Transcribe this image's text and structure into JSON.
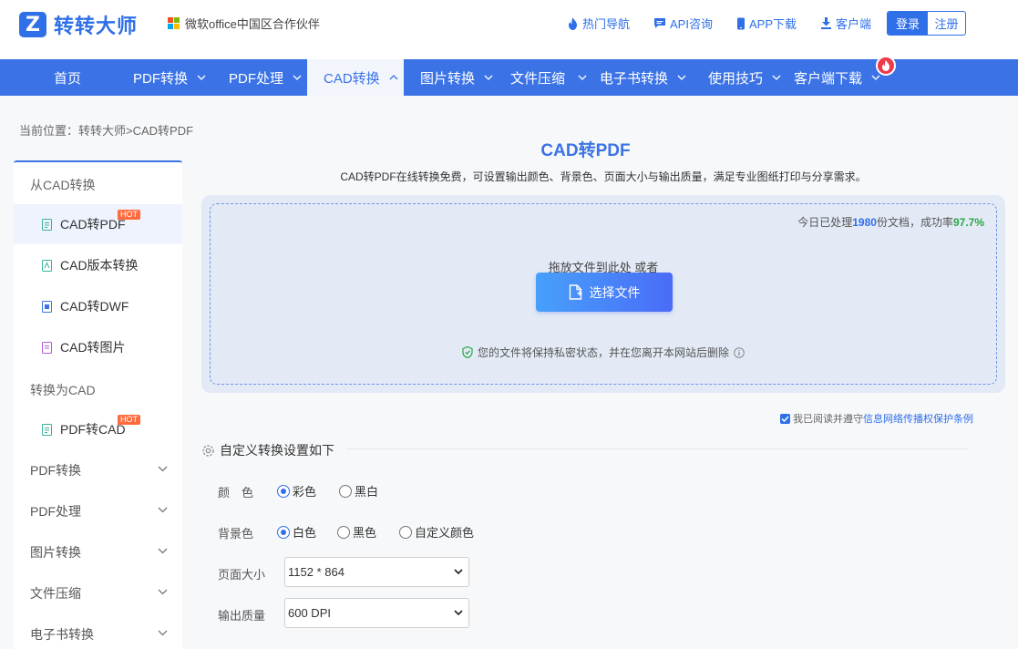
{
  "header": {
    "logo_mark": "Z",
    "logo_text": "转转大师",
    "partner": "微软office中国区合作伙伴",
    "links": [
      {
        "label": "热门导航",
        "icon": "fire-icon"
      },
      {
        "label": "API咨询",
        "icon": "chat-icon"
      },
      {
        "label": "APP下载",
        "icon": "phone-icon"
      },
      {
        "label": "客户端",
        "icon": "download-icon"
      }
    ],
    "login": "登录",
    "register": "注册"
  },
  "nav": {
    "items": [
      "首页",
      "PDF转换",
      "PDF处理",
      "CAD转换",
      "图片转换",
      "文件压缩",
      "电子书转换",
      "使用技巧",
      "客户端下载"
    ],
    "active": "CAD转换"
  },
  "breadcrumb": "当前位置：转转大师>CAD转PDF",
  "sidebar": {
    "group_from_cad": "从CAD转换",
    "items_from": [
      {
        "label": "CAD转PDF",
        "hot": "HOT",
        "active": true
      },
      {
        "label": "CAD版本转换"
      },
      {
        "label": "CAD转DWF"
      },
      {
        "label": "CAD转图片"
      }
    ],
    "group_to_cad": "转换为CAD",
    "items_to": [
      {
        "label": "PDF转CAD",
        "hot": "HOT"
      }
    ],
    "collapsibles": [
      "PDF转换",
      "PDF处理",
      "图片转换",
      "文件压缩",
      "电子书转换"
    ]
  },
  "main": {
    "title": "CAD转PDF",
    "description": "CAD转PDF在线转换免费，可设置输出颜色、背景色、页面大小与输出质量，满足专业图纸打印与分享需求。",
    "stats_prefix": "今日已处理",
    "stats_count": "1980",
    "stats_mid": "份文档，成功率",
    "stats_rate": "97.7%",
    "drop_hint": "拖放文件到此处 或者",
    "choose_button": "选择文件",
    "privacy": "您的文件将保持私密状态，并在您离开本网站后删除",
    "agree_prefix": "我已阅读并遵守",
    "agree_link": "信息网络传播权保护条例",
    "settings_title": "自定义转换设置如下"
  },
  "options": {
    "color_label": "颜　色",
    "color_choices": [
      "彩色",
      "黑白"
    ],
    "color_selected": "彩色",
    "bg_label": "背景色",
    "bg_choices": [
      "白色",
      "黑色",
      "自定义颜色"
    ],
    "bg_selected": "白色",
    "page_size_label": "页面大小",
    "page_size_value": "1152 * 864",
    "quality_label": "输出质量",
    "quality_value": "600 DPI"
  },
  "colors": {
    "brand": "#2f6fe8",
    "nav_bg": "#3b73e6",
    "hot": "#ff6b3d",
    "success": "#28a745"
  }
}
